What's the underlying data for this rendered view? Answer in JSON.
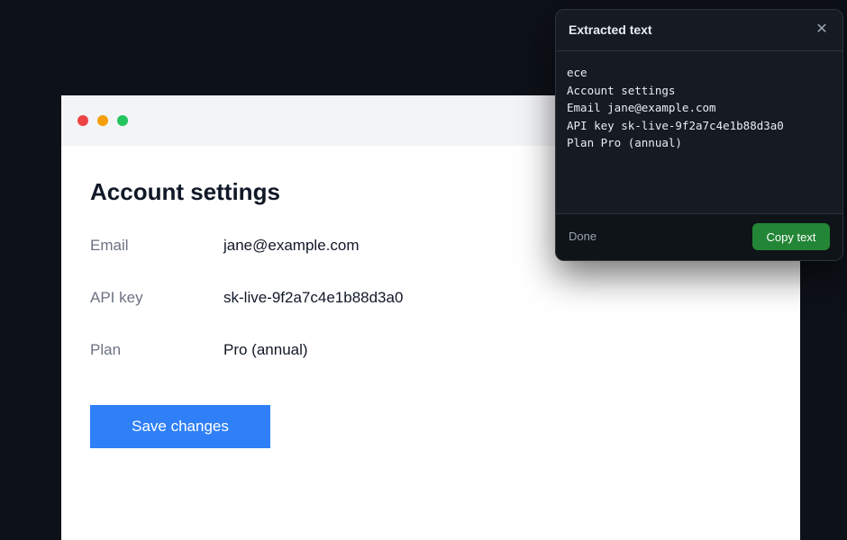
{
  "account": {
    "title": "Account settings",
    "fields": [
      {
        "label": "Email",
        "value": "jane@example.com"
      },
      {
        "label": "API key",
        "value": "sk-live-9f2a7c4e1b88d3a0"
      },
      {
        "label": "Plan",
        "value": "Pro (annual)"
      }
    ],
    "save_label": "Save changes"
  },
  "popup": {
    "title": "Extracted text",
    "close_icon": "close-icon",
    "lines": [
      "ece",
      "Account settings",
      "Email jane@example.com",
      "API key sk-live-9f2a7c4e1b88d3a0",
      "Plan Pro (annual)"
    ],
    "done_label": "Done",
    "copy_label": "Copy text"
  },
  "colors": {
    "background": "#0d1118",
    "primary_button": "#2f80f7",
    "copy_button": "#238636",
    "traffic_red": "#ef4444",
    "traffic_yellow": "#f59e0b",
    "traffic_green": "#22c55e"
  }
}
